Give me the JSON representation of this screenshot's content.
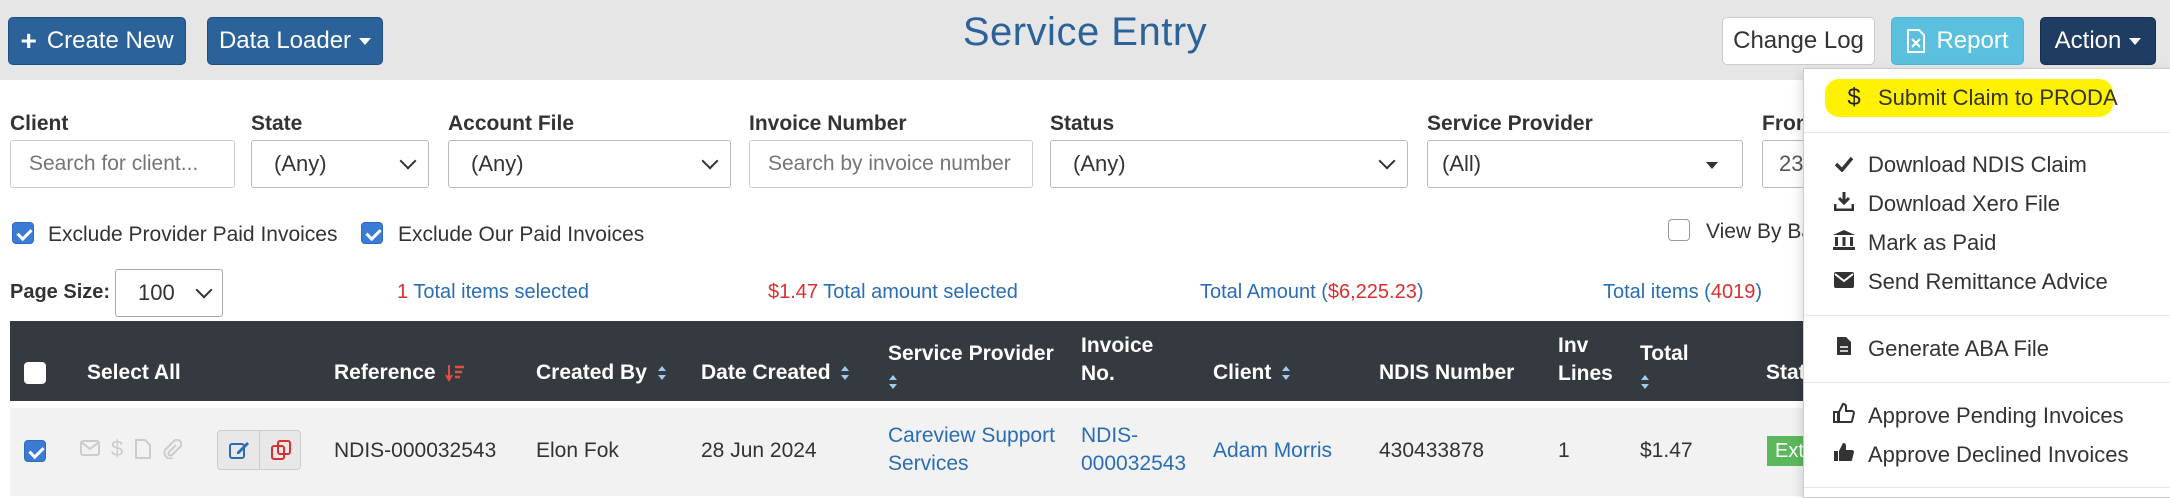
{
  "header": {
    "title": "Service Entry",
    "create_new_label": "Create New",
    "data_loader_label": "Data Loader",
    "change_log_label": "Change Log",
    "report_label": "Report",
    "action_label": "Action"
  },
  "filters": {
    "client": {
      "label": "Client",
      "placeholder": "Search for client..."
    },
    "state": {
      "label": "State",
      "value": "(Any)"
    },
    "account_file": {
      "label": "Account File",
      "value": "(Any)"
    },
    "invoice_number": {
      "label": "Invoice Number",
      "placeholder": "Search by invoice number"
    },
    "status": {
      "label": "Status",
      "value": "(Any)"
    },
    "service_provider": {
      "label": "Service Provider",
      "value": "(All)"
    },
    "from": {
      "label": "From",
      "value": "23"
    }
  },
  "checkboxes": {
    "exclude_provider_paid": {
      "label": "Exclude Provider Paid Invoices",
      "checked": true
    },
    "exclude_our_paid": {
      "label": "Exclude Our Paid Invoices",
      "checked": true
    },
    "view_by_batch": {
      "label": "View By Ba",
      "checked": false
    }
  },
  "summary": {
    "page_size_label": "Page Size:",
    "page_size_value": "100",
    "selected_count": "1",
    "selected_count_text": "Total items selected",
    "selected_amount": "$1.47",
    "selected_amount_text": "Total amount selected",
    "total_amount_text": "Total Amount",
    "total_amount_open": "(",
    "total_amount_value": "$6,225.23",
    "total_amount_close": ")",
    "total_items_text": "Total items",
    "total_items_open": "(",
    "total_items_value": "4019",
    "total_items_close": ")"
  },
  "table": {
    "headers": {
      "select_all": "Select All",
      "reference": "Reference",
      "created_by": "Created By",
      "date_created": "Date Created",
      "service_provider": "Service Provider",
      "invoice_no_1": "Invoice",
      "invoice_no_2": "No.",
      "client": "Client",
      "ndis_number": "NDIS Number",
      "inv_lines_1": "Inv",
      "inv_lines_2": "Lines",
      "total": "Total",
      "status": "Stat"
    },
    "rows": [
      {
        "checked": true,
        "reference": "NDIS-000032543",
        "created_by": "Elon Fok",
        "date_created": "28 Jun 2024",
        "service_provider_1": "Careview Support",
        "service_provider_2": "Services",
        "invoice_no_1": "NDIS-",
        "invoice_no_2": "000032543",
        "client": "Adam Morris",
        "ndis_number": "430433878",
        "inv_lines": "1",
        "total": "$1.47",
        "status": "Ext"
      }
    ]
  },
  "action_menu": {
    "items": [
      {
        "label": "Submit Claim to PRODA",
        "icon": "dollar-icon",
        "highlighted": true
      },
      {
        "label": "Download NDIS Claim",
        "icon": "check-icon"
      },
      {
        "label": "Download Xero File",
        "icon": "download-icon"
      },
      {
        "label": "Mark as Paid",
        "icon": "bank-icon"
      },
      {
        "label": "Send Remittance Advice",
        "icon": "envelope-icon"
      },
      {
        "label": "Generate ABA File",
        "icon": "file-icon"
      },
      {
        "label": "Approve Pending Invoices",
        "icon": "thumbs-up-outline-icon"
      },
      {
        "label": "Approve Declined Invoices",
        "icon": "thumbs-up-icon"
      }
    ]
  },
  "colors": {
    "primary": "#2a6299",
    "info": "#5bc0de",
    "dark": "#1f3c63",
    "table_header": "#343a40",
    "link": "#2a6db5",
    "danger": "#d9302f",
    "highlight": "#fff200",
    "status_green": "#5cb85c"
  }
}
